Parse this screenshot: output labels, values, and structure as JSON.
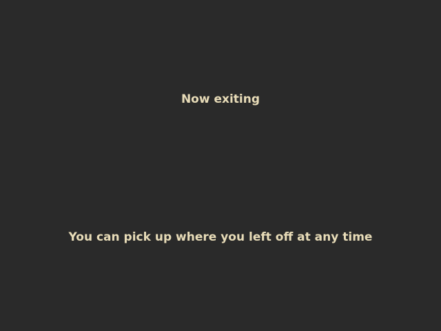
{
  "exit_screen": {
    "title": "Now exiting",
    "message": "You can pick up where you left off at any time"
  },
  "colors": {
    "background": "#2a2a2a",
    "text": "#e8dcb8"
  }
}
